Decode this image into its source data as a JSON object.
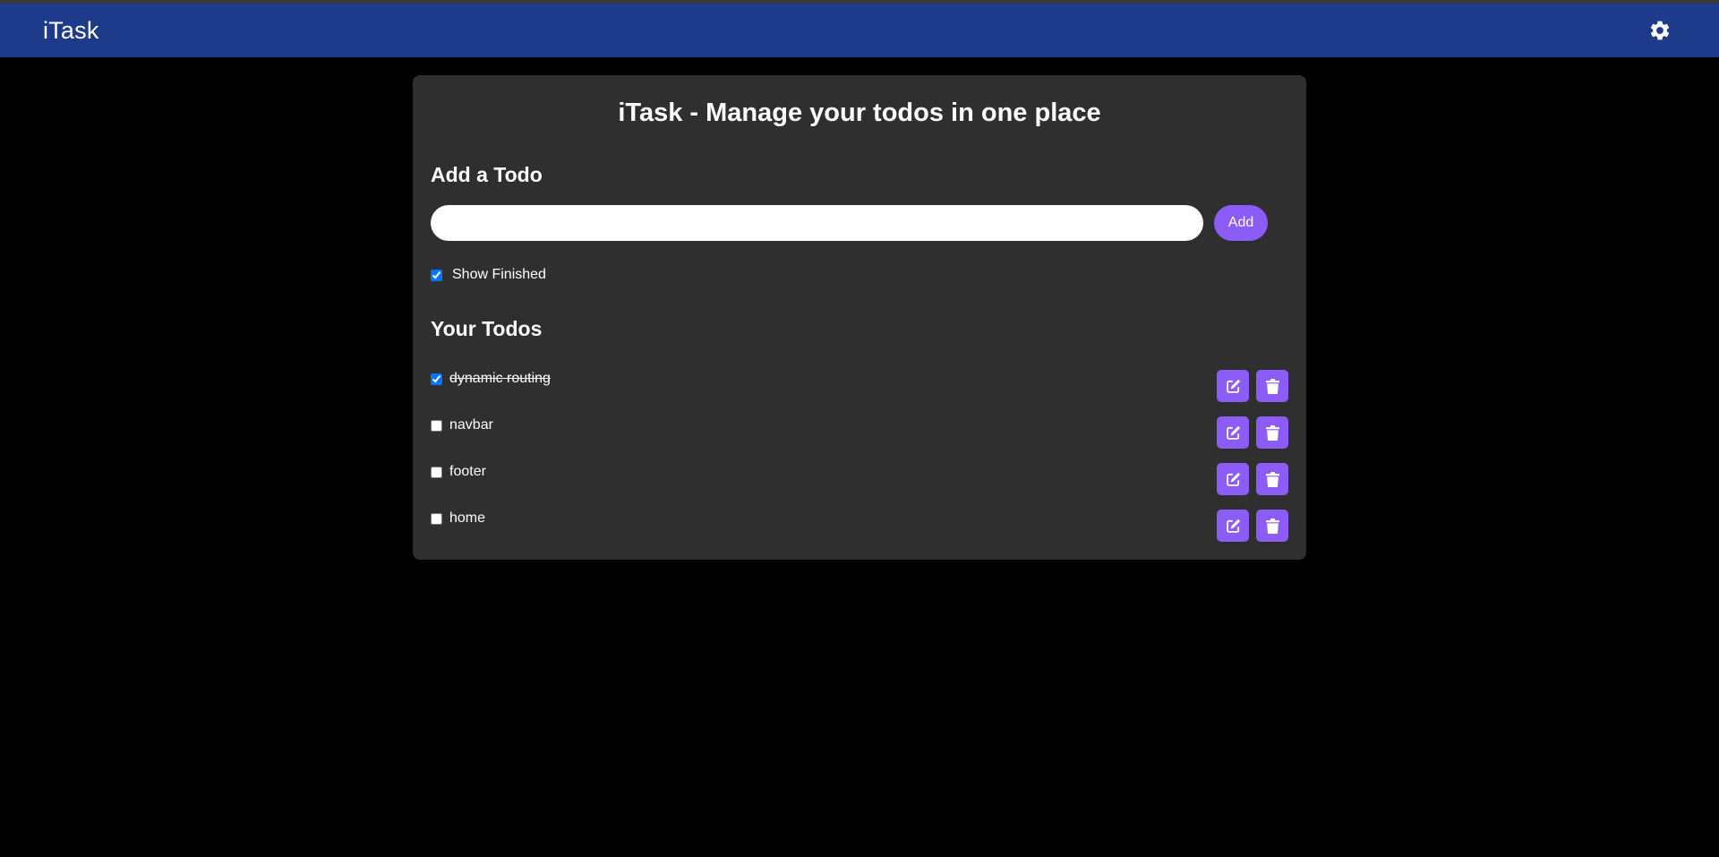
{
  "navbar": {
    "brand": "iTask",
    "settings_icon": "gear-icon"
  },
  "card": {
    "title": "iTask - Manage your todos in one place",
    "add_section_title": "Add a Todo",
    "input": {
      "value": "",
      "placeholder": ""
    },
    "add_button_label": "Add",
    "show_finished": {
      "label": "Show Finished",
      "checked": true
    },
    "todos_section_title": "Your Todos",
    "todos": [
      {
        "text": "dynamic routing",
        "completed": true
      },
      {
        "text": "navbar",
        "completed": false
      },
      {
        "text": "footer",
        "completed": false
      },
      {
        "text": "home",
        "completed": false
      }
    ],
    "edit_icon": "edit-icon",
    "delete_icon": "trash-icon"
  },
  "colors": {
    "navbar": "#1e3a8a",
    "background": "#000000",
    "card": "#2f2f2f",
    "accent": "#8b5cf6"
  }
}
